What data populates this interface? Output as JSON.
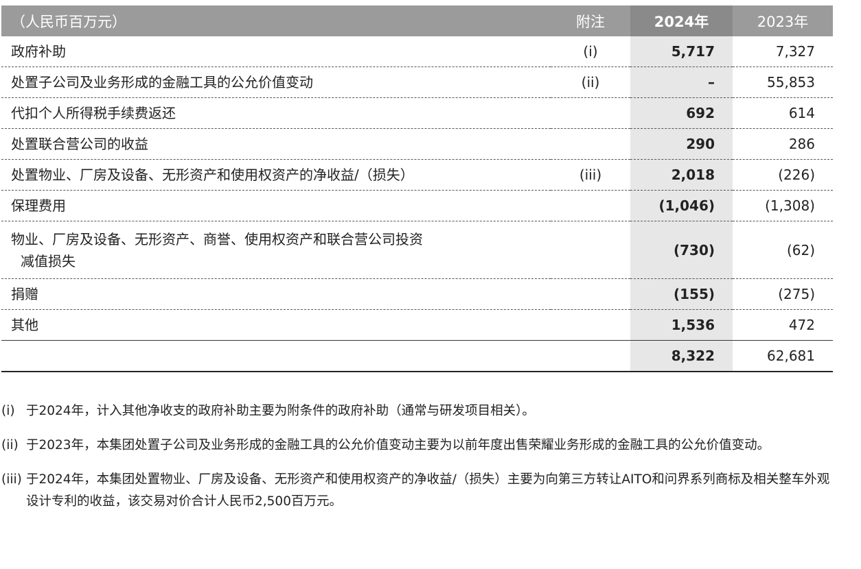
{
  "table": {
    "headers": {
      "label": "（人民币百万元）",
      "note": "附注",
      "y2024": "2024年",
      "y2023": "2023年"
    },
    "rows": [
      {
        "label": "政府补助",
        "note": "(i)",
        "v2024": "5,717",
        "v2023": "7,327"
      },
      {
        "label": "处置子公司及业务形成的金融工具的公允价值变动",
        "note": "(ii)",
        "v2024": "–",
        "v2023": "55,853"
      },
      {
        "label": "代扣个人所得税手续费返还",
        "note": "",
        "v2024": "692",
        "v2023": "614"
      },
      {
        "label": "处置联合营公司的收益",
        "note": "",
        "v2024": "290",
        "v2023": "286"
      },
      {
        "label": "处置物业、厂房及设备、无形资产和使用权资产的净收益/（损失）",
        "note": "(iii)",
        "v2024": "2,018",
        "v2023": "(226)"
      },
      {
        "label": "保理费用",
        "note": "",
        "v2024": "(1,046)",
        "v2023": "(1,308)"
      },
      {
        "label": "物业、厂房及设备、无形资产、商誉、使用权资产和联合营公司投资",
        "label_line2": "减值损失",
        "note": "",
        "v2024": "(730)",
        "v2023": "(62)"
      },
      {
        "label": "捐赠",
        "note": "",
        "v2024": "(155)",
        "v2023": "(275)"
      },
      {
        "label": "其他",
        "note": "",
        "v2024": "1,536",
        "v2023": "472"
      }
    ],
    "total": {
      "v2024": "8,322",
      "v2023": "62,681"
    }
  },
  "notes": [
    {
      "marker": "(i)",
      "text": "于2024年，计入其他净收支的政府补助主要为附条件的政府补助（通常与研发项目相关）。"
    },
    {
      "marker": "(ii)",
      "text": "于2023年，本集团处置子公司及业务形成的金融工具的公允价值变动主要为以前年度出售荣耀业务形成的金融工具的公允价值变动。"
    },
    {
      "marker": "(iii)",
      "text": "于2024年，本集团处置物业、厂房及设备、无形资产和使用权资产的净收益/（损失）主要为向第三方转让AITO和问界系列商标及相关整车外观设计专利的收益，该交易对价合计人民币2,500百万元。"
    }
  ]
}
